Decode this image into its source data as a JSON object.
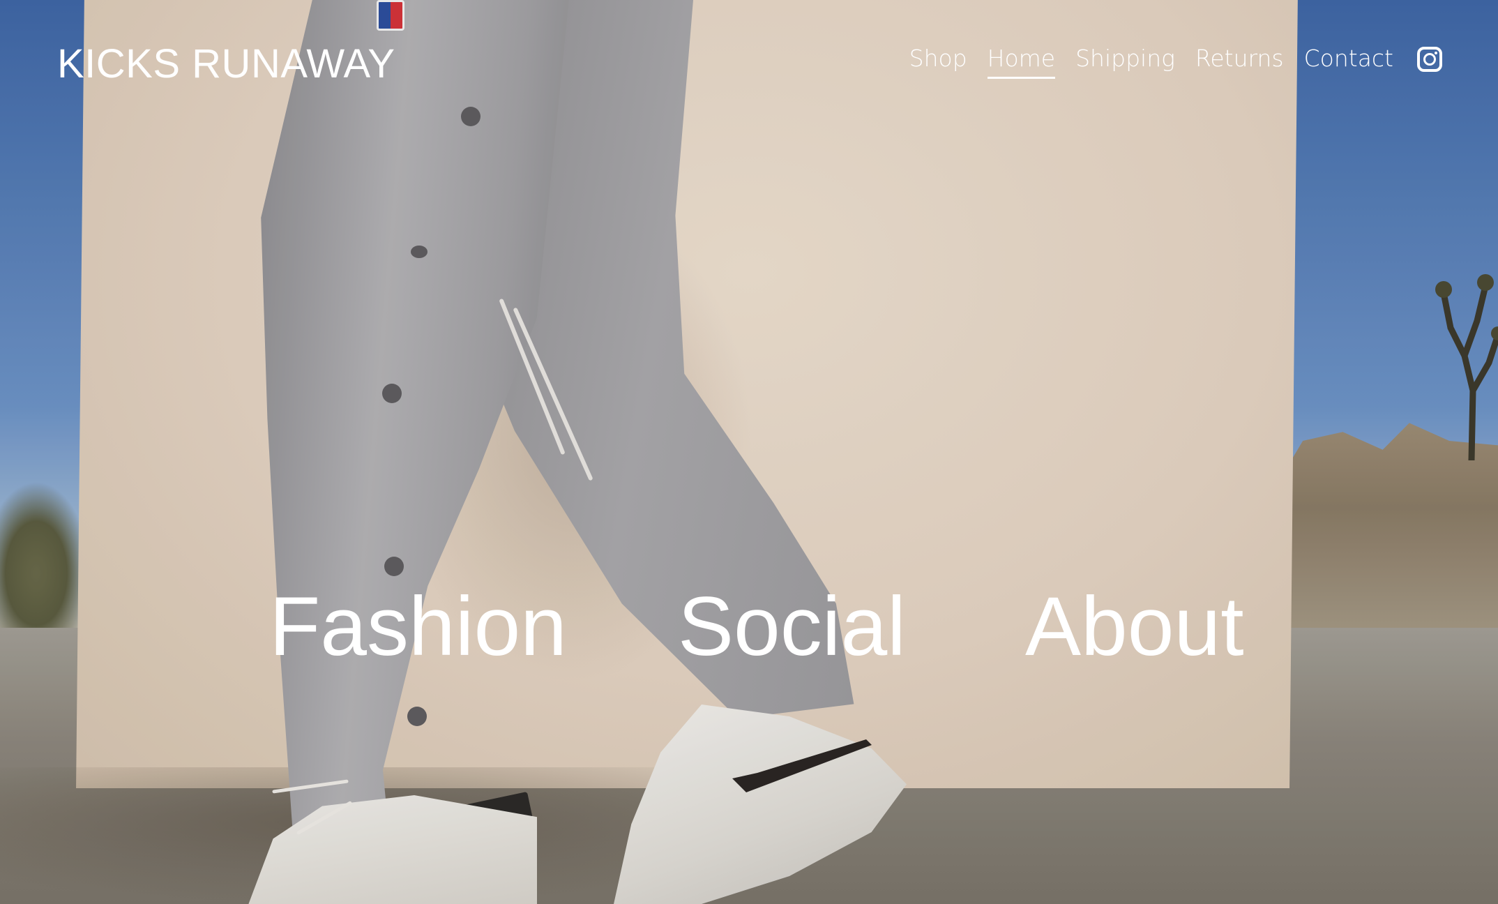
{
  "brand": {
    "name": "KICKS RUNAWAY"
  },
  "nav": {
    "items": [
      {
        "label": "Shop"
      },
      {
        "label": "Home",
        "active": true
      },
      {
        "label": "Shipping"
      },
      {
        "label": "Returns"
      },
      {
        "label": "Contact"
      }
    ],
    "social_icon": "instagram-icon"
  },
  "hero": {
    "sections": [
      {
        "label": "Fashion"
      },
      {
        "label": "Social"
      },
      {
        "label": "About"
      }
    ]
  },
  "colors": {
    "text": "#ffffff",
    "sky": "#4f77b3",
    "wall": "#e6d7c7",
    "pants": "#a7a6a9"
  }
}
